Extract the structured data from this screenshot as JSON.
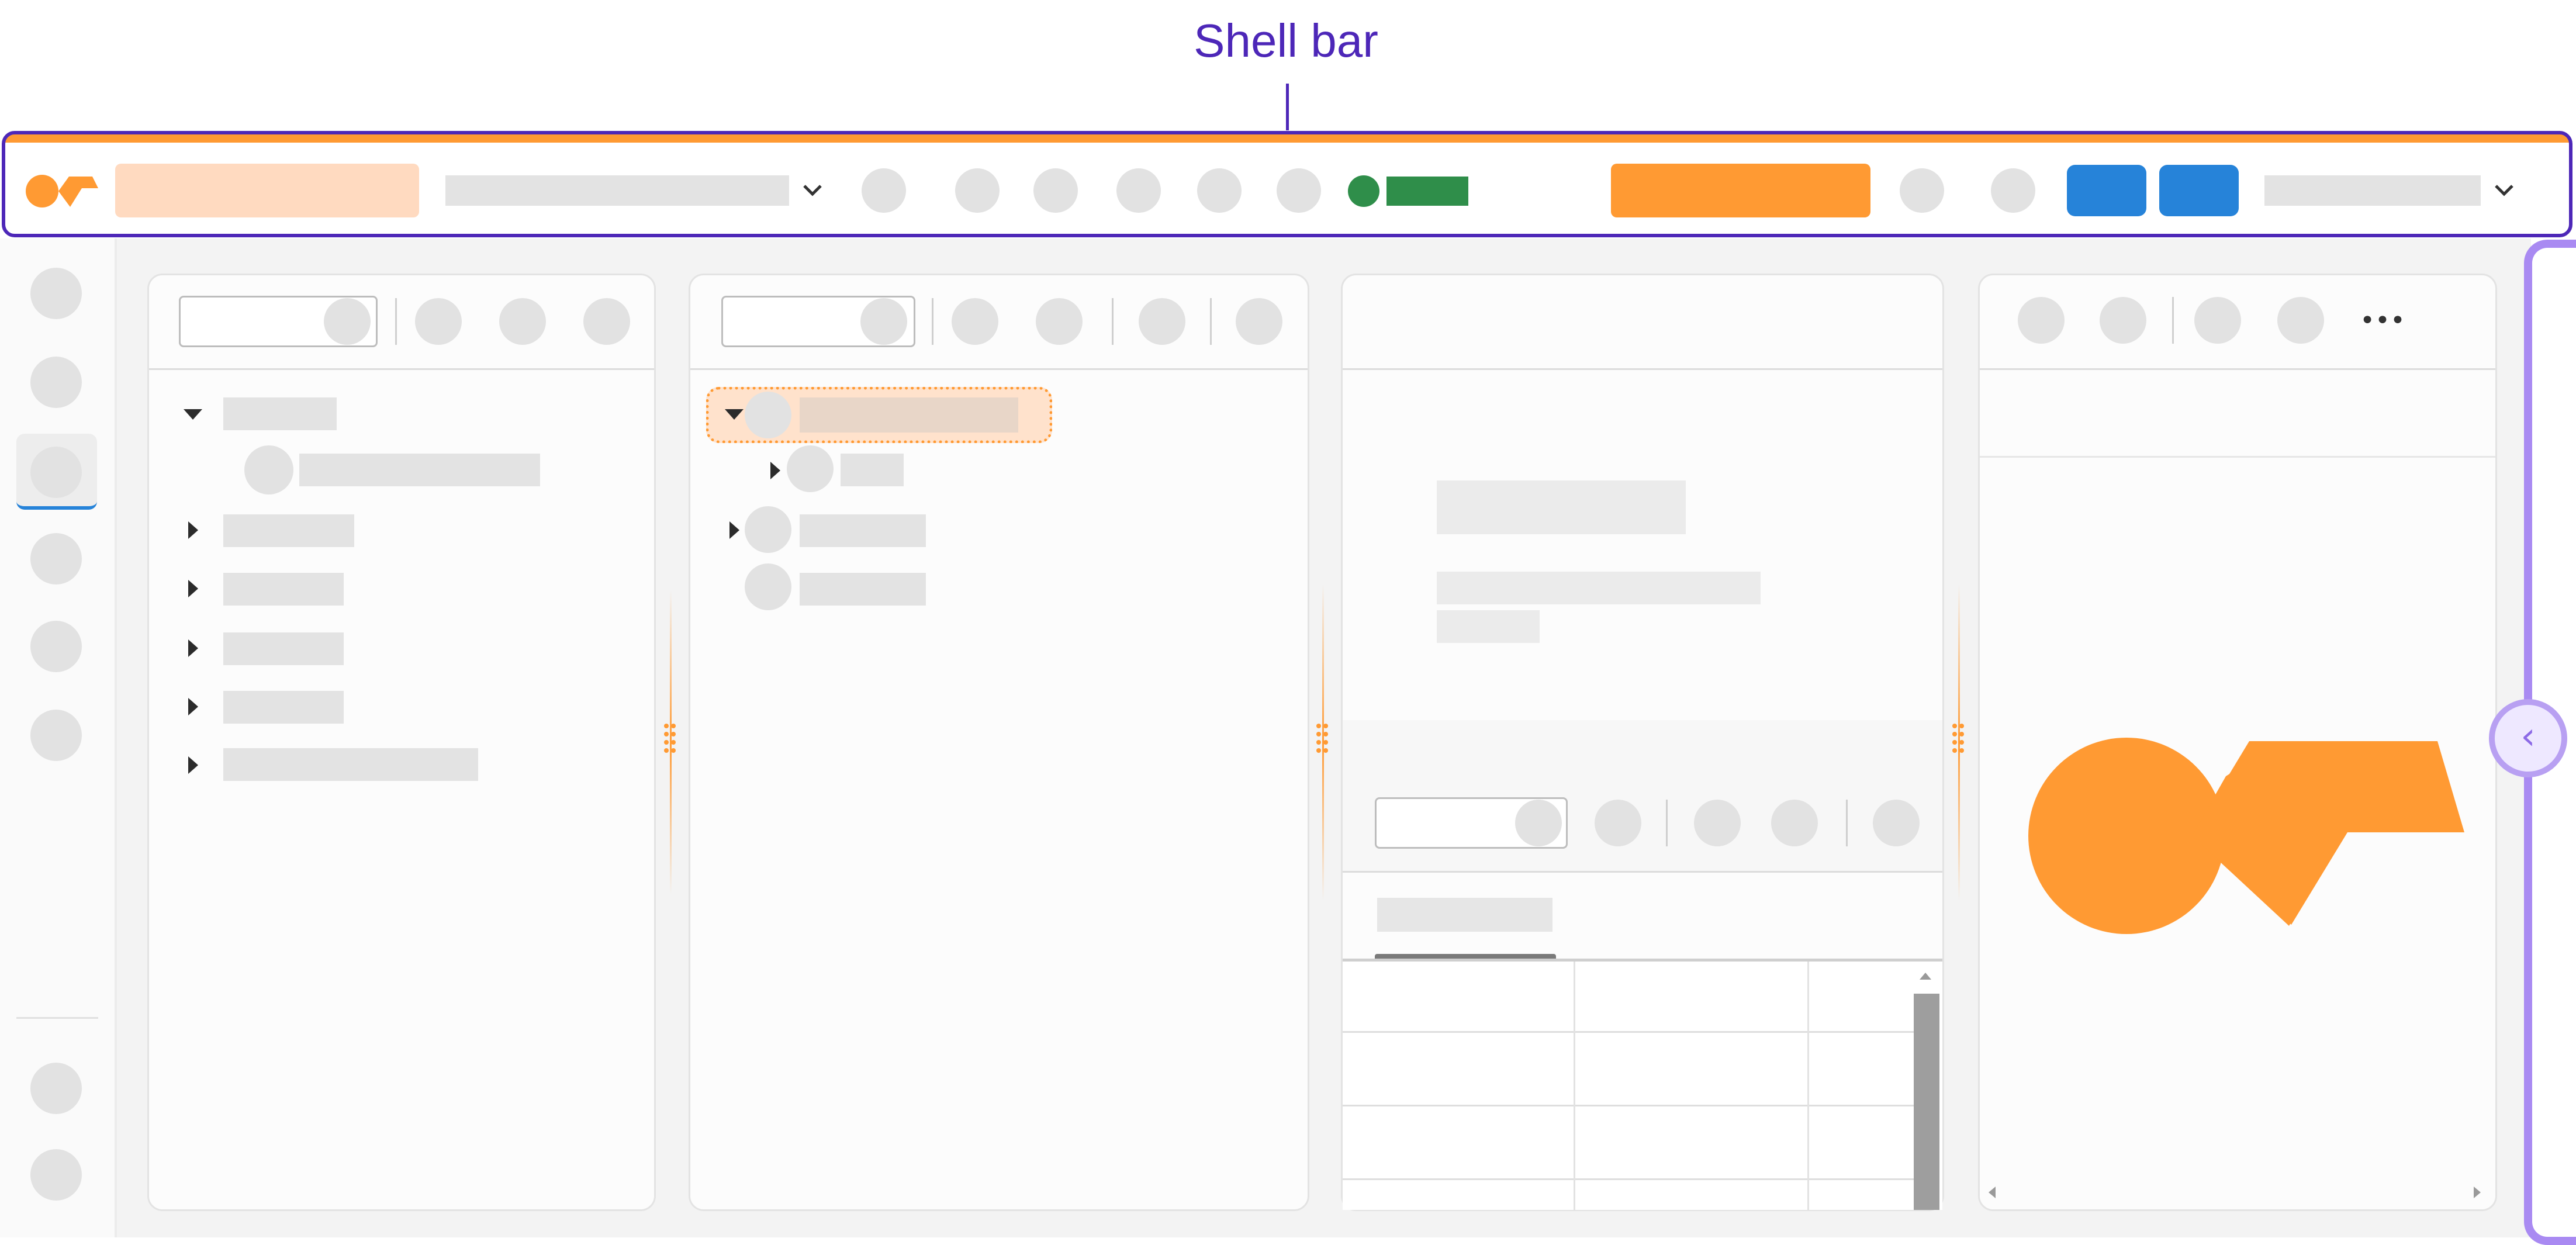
{
  "callout": {
    "label": "Shell bar"
  },
  "icons": {
    "logo": "brand-logo-icon",
    "chevron": "chevron-down-icon",
    "collapse": "chevron-left-icon",
    "overflow": "more-horizontal-icon",
    "expand": "caret-down-icon",
    "collapsed": "caret-right-icon"
  },
  "colors": {
    "accent": "#ff9a33",
    "accent_light": "#ffdac0",
    "callout": "#4d27b8",
    "status_green": "#2f8e4a",
    "primary_blue": "#2683d9",
    "side_handle": "#a98af2",
    "placeholder": "#e3e3e3"
  },
  "shellbar": {
    "overflow_glyph": "•••"
  },
  "collapse_handle": {
    "glyph": "‹"
  }
}
